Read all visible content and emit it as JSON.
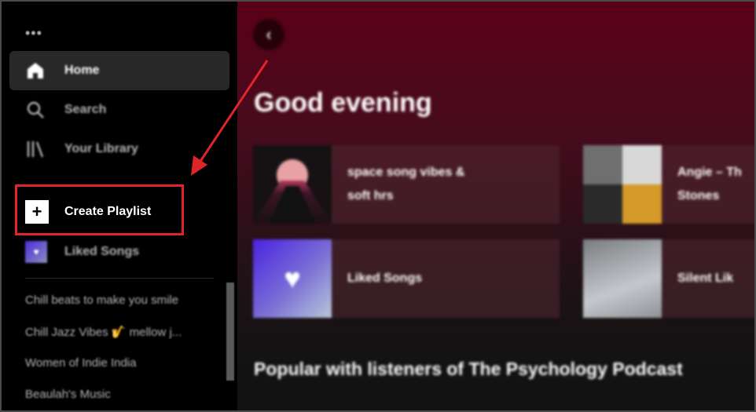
{
  "sidebar": {
    "more_label": "•••",
    "nav": [
      {
        "label": "Home",
        "icon": "home-icon",
        "active": true
      },
      {
        "label": "Search",
        "icon": "search-icon",
        "active": false
      },
      {
        "label": "Your Library",
        "icon": "library-icon",
        "active": false
      }
    ],
    "create_playlist": {
      "icon": "plus-icon",
      "plus": "+",
      "label": "Create Playlist"
    },
    "liked_songs": {
      "icon": "heart-icon",
      "label": "Liked Songs"
    },
    "playlists": [
      "Chill beats to make you smile",
      "Chill Jazz Vibes 🎷 mellow j...",
      "Women of Indie India",
      "Beaulah's Music"
    ]
  },
  "main": {
    "back_icon": "chevron-left-icon",
    "back_glyph": "‹",
    "greeting": "Good evening",
    "cards": [
      {
        "label_line1": "space song vibes &",
        "label_line2": "soft hrs"
      },
      {
        "label_line1": "Angie – Th",
        "label_line2": "Stones"
      },
      {
        "label_line1": "Liked Songs",
        "label_line2": ""
      },
      {
        "label_line1": "Silent Lik",
        "label_line2": ""
      }
    ],
    "heart_glyph": "♥",
    "section_title": "Popular with listeners of The Psychology Podcast"
  },
  "annotation": {
    "color": "#e0242b"
  },
  "colors": {
    "background": "#000000",
    "active_nav": "#282828",
    "main_gradient_top": "#5a0016",
    "text_dim": "#b3b3b3"
  }
}
